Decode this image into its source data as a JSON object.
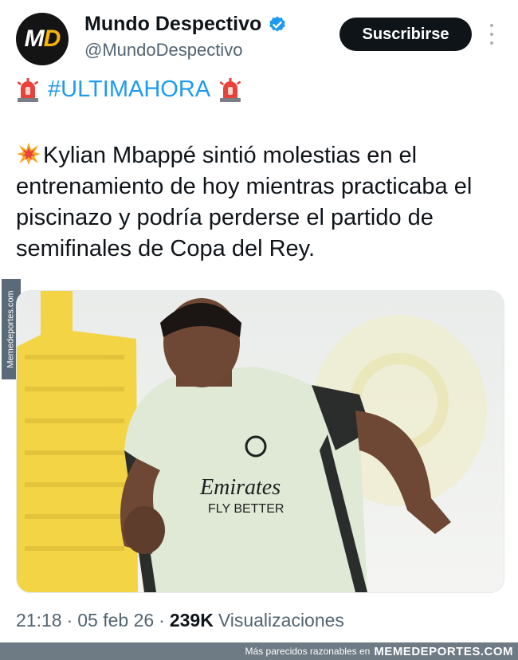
{
  "account": {
    "avatar_letter_1": "M",
    "avatar_letter_2": "D",
    "name": "Mundo Despectivo",
    "handle": "@MundoDespectivo",
    "verified_icon": "verified-badge-icon"
  },
  "actions": {
    "subscribe_label": "Suscribirse",
    "more_icon": "more-options-icon"
  },
  "tweet": {
    "hashtag": "#ULTIMAHORA",
    "emoji_left": "siren-icon",
    "emoji_right": "siren-icon",
    "lead_emoji": "collision-icon",
    "text": "Kylian Mbappé sintió molestias en el entrenamiento de hoy mientras practicaba el piscinazo y podría perderse el partido de semifinales de Copa del Rey.",
    "image_caption_text": "Emirates FLY BETTER"
  },
  "meta": {
    "time": "21:18",
    "date": "05 feb 26",
    "views_count": "239K",
    "views_label": "Visualizaciones"
  },
  "watermark": {
    "side": "Memedeportes.com",
    "footer_text": "Más parecidos razonables en",
    "footer_brand": "MEMEDEPORTES.COM"
  },
  "colors": {
    "accent": "#1d9bf0",
    "text": "#0f1419",
    "muted": "#536471",
    "button_bg": "#0f1419"
  }
}
